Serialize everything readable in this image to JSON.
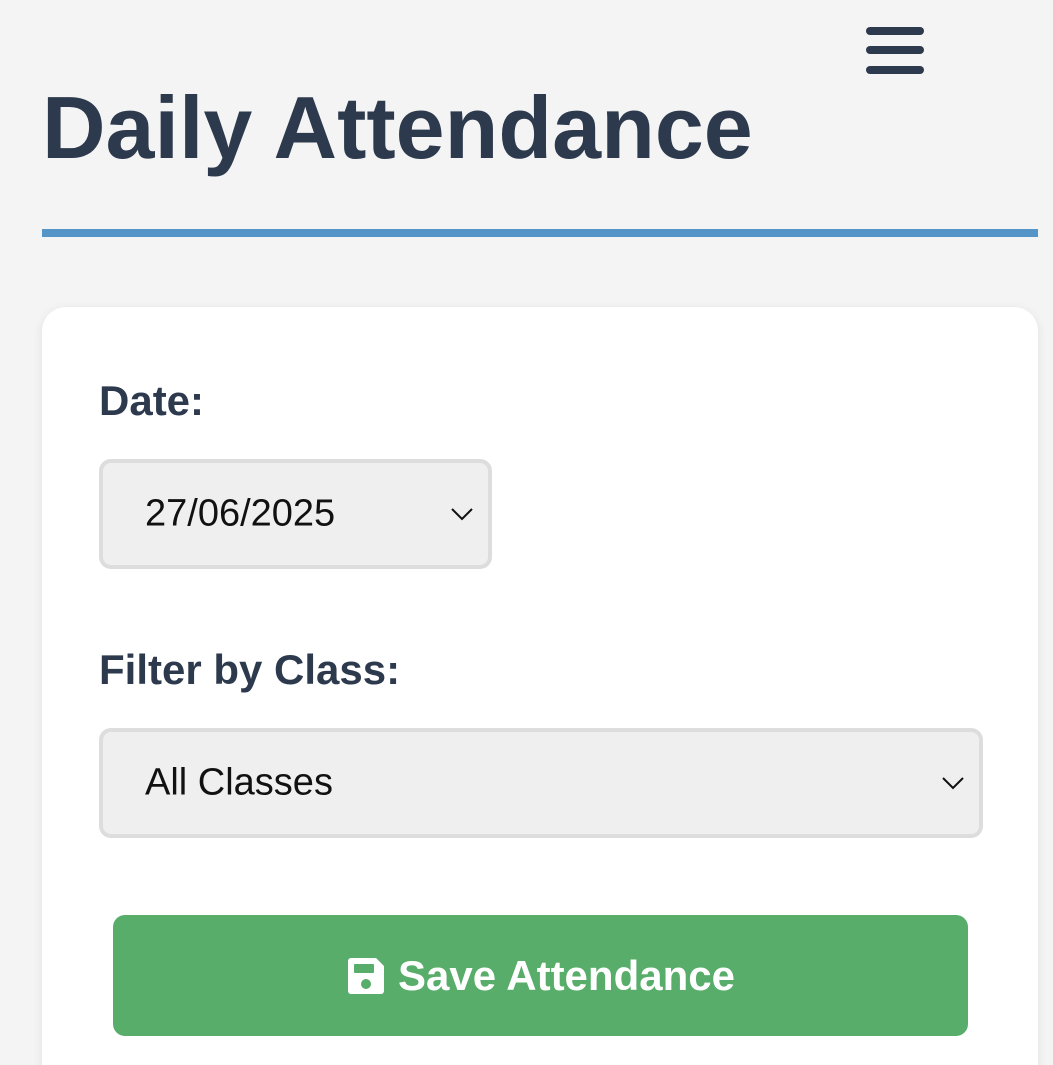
{
  "header": {
    "menu_icon": "hamburger-menu-icon",
    "title": "Daily Attendance",
    "accent_color": "#5594c6"
  },
  "form": {
    "date_label": "Date:",
    "date_value": "27/06/2025",
    "class_label": "Filter by Class:",
    "class_value": "All Classes",
    "dropdown_icon": "chevron-down-icon",
    "save_icon": "floppy-disk-icon",
    "save_label": "Save Attendance",
    "save_color": "#57ad69"
  }
}
